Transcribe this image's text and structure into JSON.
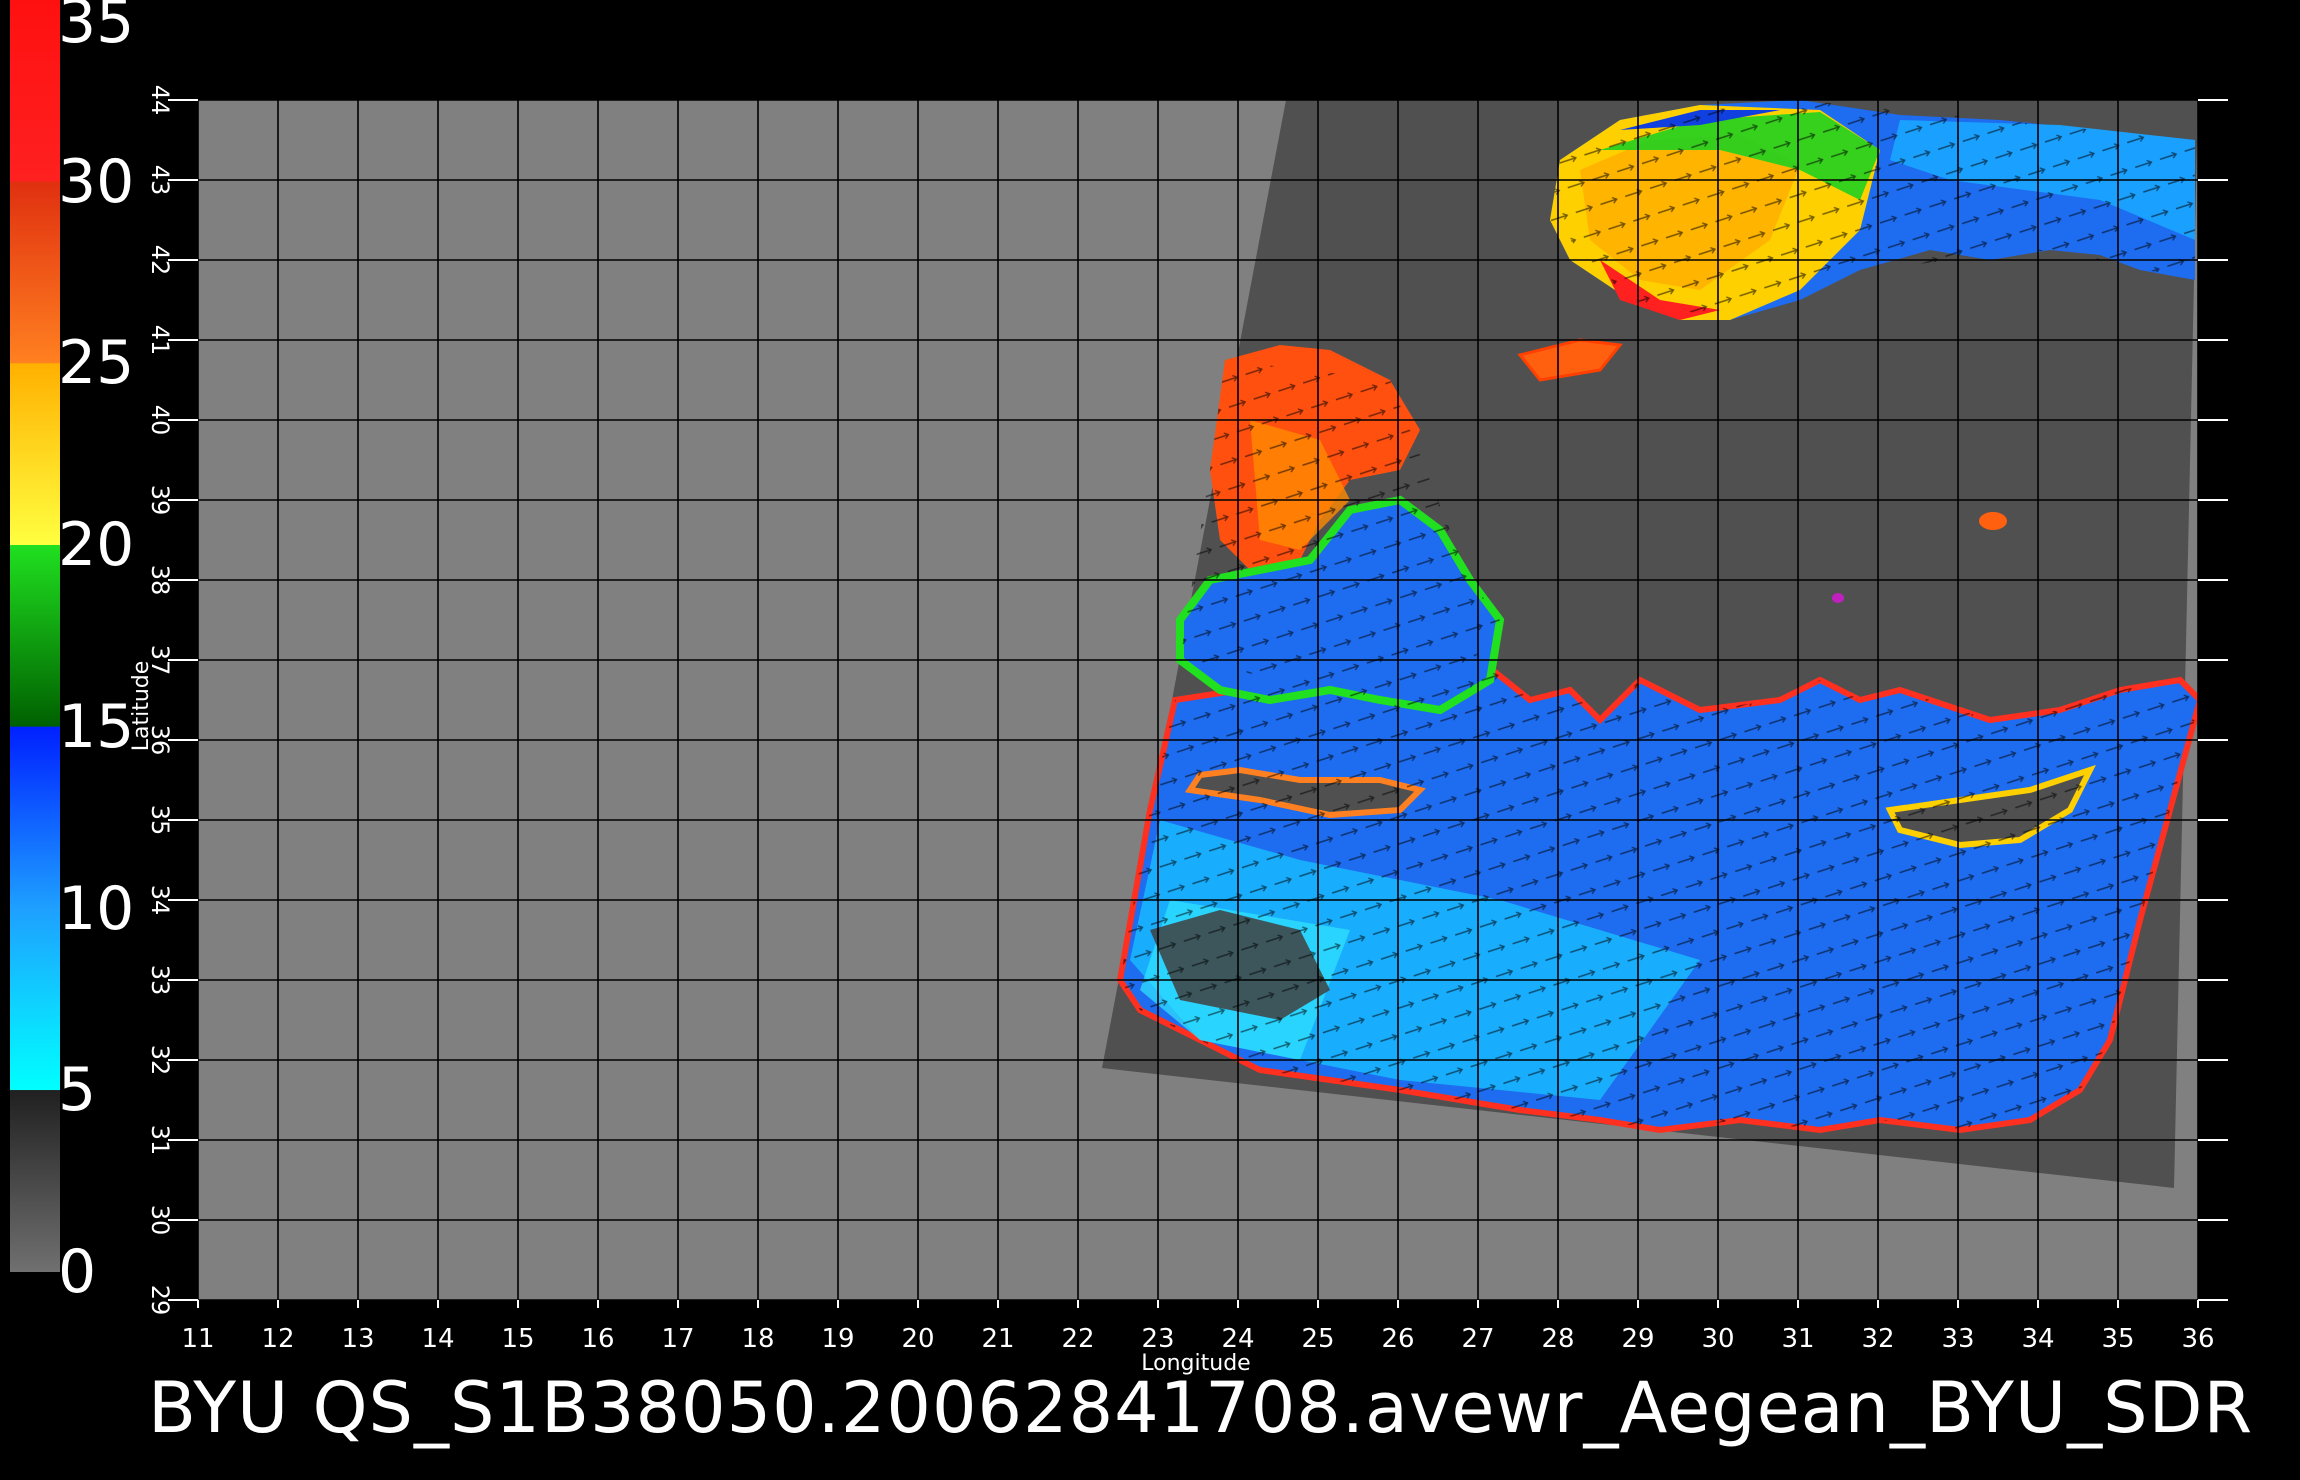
{
  "colorbar": {
    "ticks": [
      "0",
      "5",
      "10",
      "15",
      "20",
      "25",
      "30",
      "35"
    ],
    "min": 0,
    "max": 35,
    "stops": [
      {
        "value": 0,
        "color": "#707070"
      },
      {
        "value": 5,
        "color": "#202020"
      },
      {
        "value": 5.01,
        "color": "#00ffff"
      },
      {
        "value": 10,
        "color": "#1ea0ff"
      },
      {
        "value": 15,
        "color": "#0020ff"
      },
      {
        "value": 15.01,
        "color": "#006000"
      },
      {
        "value": 20,
        "color": "#20e020"
      },
      {
        "value": 20.01,
        "color": "#ffff40"
      },
      {
        "value": 25,
        "color": "#ffb000"
      },
      {
        "value": 25.01,
        "color": "#ff8020"
      },
      {
        "value": 30,
        "color": "#e03010"
      },
      {
        "value": 30.01,
        "color": "#ff2020"
      },
      {
        "value": 35,
        "color": "#ff1010"
      },
      {
        "value": 35.01,
        "color": "#c08060"
      }
    ]
  },
  "map": {
    "lon_min": 11,
    "lon_max": 36,
    "lat_min": 29,
    "lat_max": 44,
    "xlabel": "Longitude",
    "ylabel": "Latitude",
    "x_ticks": [
      "11",
      "12",
      "13",
      "14",
      "15",
      "16",
      "17",
      "18",
      "19",
      "20",
      "21",
      "22",
      "23",
      "24",
      "25",
      "26",
      "27",
      "28",
      "29",
      "30",
      "31",
      "32",
      "33",
      "34",
      "35",
      "36"
    ],
    "y_ticks": [
      "29",
      "30",
      "31",
      "32",
      "33",
      "34",
      "35",
      "36",
      "37",
      "38",
      "39",
      "40",
      "41",
      "42",
      "43",
      "44"
    ],
    "grid": true,
    "background_color": "#808080",
    "swath_color": "#505050",
    "swath_corners": [
      [
        24.6,
        44.0
      ],
      [
        36.0,
        44.0
      ],
      [
        35.7,
        30.4
      ],
      [
        22.3,
        31.9
      ]
    ]
  },
  "caption": "BYU  QS_S1B38050.20062841708.avewr_Aegean_BYU_SDR"
}
